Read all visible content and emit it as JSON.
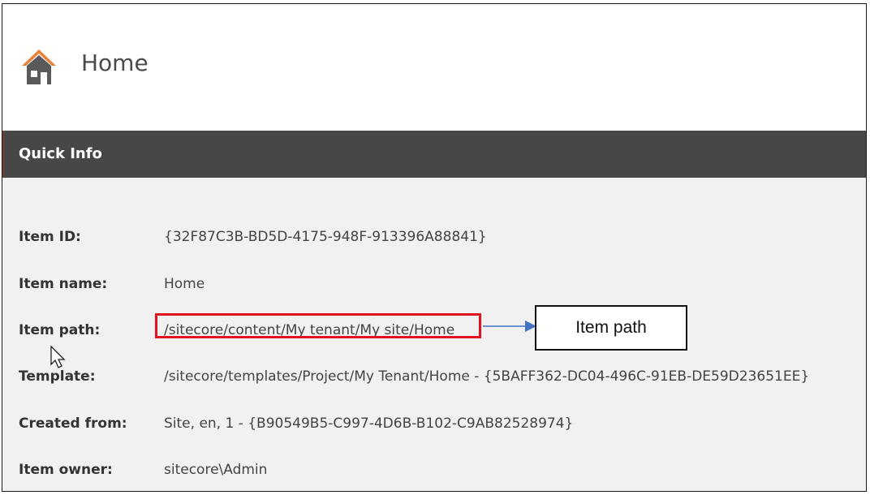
{
  "header": {
    "title": "Home",
    "icon": "home-icon"
  },
  "quick_info": {
    "section_title": "Quick Info",
    "fields": [
      {
        "label": "Item ID:",
        "value": "{32F87C3B-BD5D-4175-948F-913396A88841}"
      },
      {
        "label": "Item name:",
        "value": "Home"
      },
      {
        "label": "Item path:",
        "value": "/sitecore/content/My tenant/My site/Home"
      },
      {
        "label": "Template:",
        "value": "/sitecore/templates/Project/My Tenant/Home - {5BAFF362-DC04-496C-91EB-DE59D23651EE}"
      },
      {
        "label": "Created from:",
        "value": "Site, en, 1 - {B90549B5-C997-4D6B-B102-C9AB82528974}"
      },
      {
        "label": "Item owner:",
        "value": "sitecore\\Admin"
      }
    ]
  },
  "annotation": {
    "callout_text": "Item path",
    "highlight_color": "#e0141e",
    "arrow_color": "#4472c4"
  },
  "colors": {
    "section_bar": "#474747",
    "content_bg": "#f1f1f1",
    "icon_roof": "#e8823a",
    "icon_house": "#5a5a5a"
  }
}
